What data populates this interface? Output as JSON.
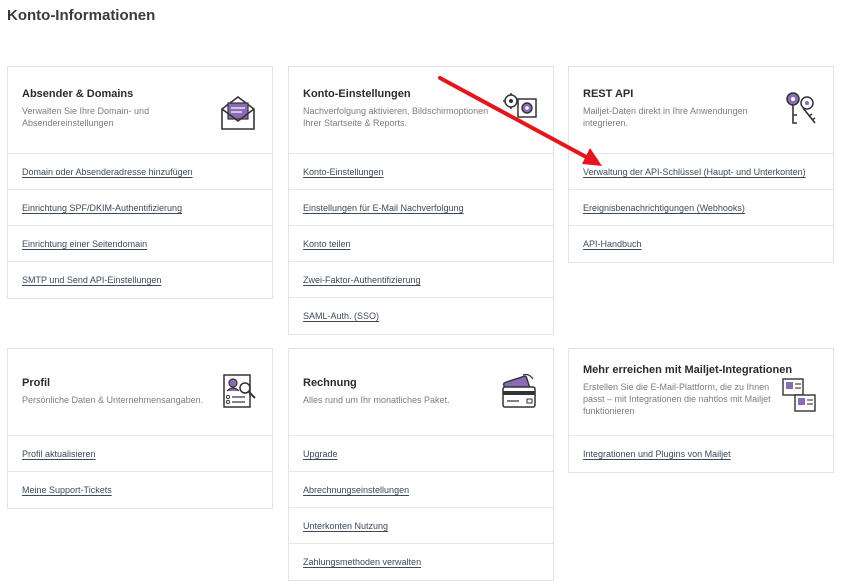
{
  "page_title": "Konto-Informationen",
  "cards": {
    "sender": {
      "title": "Absender & Domains",
      "description": "Verwalten Sie Ihre Domain- und Absendereinstellungen",
      "icon": "envelope-icon",
      "links": [
        "Domain oder Absenderadresse hinzufügen",
        "Einrichtung SPF/DKIM-Authentifizierung",
        "Einrichtung einer Seitendomain",
        "SMTP und Send API-Einstellungen"
      ]
    },
    "account": {
      "title": "Konto-Einstellungen",
      "description": "Nachverfolgung aktivieren, Bildschirmoptionen Ihrer Startseite & Reports.",
      "icon": "gears-icon",
      "links": [
        "Konto-Einstellungen",
        "Einstellungen für E-Mail Nachverfolgung",
        "Konto teilen",
        "Zwei-Faktor-Authentifizierung",
        "SAML-Auth. (SSO)"
      ]
    },
    "rest_api": {
      "title": "REST API",
      "description": "Mailjet-Daten direkt in Ihre Anwendungen integrieren.",
      "icon": "keys-icon",
      "links": [
        "Verwaltung der API-Schlüssel (Haupt- und Unterkonten)",
        "Ereignisbenachrichtigungen (Webhooks)",
        "API-Handbuch"
      ]
    },
    "profile": {
      "title": "Profil",
      "description": "Persönliche Daten & Unternehmensangaben.",
      "icon": "profile-card-icon",
      "links": [
        "Profil aktualisieren",
        "Meine Support-Tickets"
      ]
    },
    "billing": {
      "title": "Rechnung",
      "description": "Alles rund um Ihr monatliches Paket.",
      "icon": "credit-card-icon",
      "links": [
        "Upgrade",
        "Abrechnungseinstellungen",
        "Unterkonten Nutzung",
        "Zahlungsmethoden verwalten"
      ]
    },
    "integrations": {
      "title": "Mehr erreichen mit Mailjet-Integrationen",
      "description": "Erstellen Sie die E-Mail-Plattform, die zu Ihnen passt – mit Integrationen die nahtlos mit Mailjet funktionieren",
      "icon": "integrations-icon",
      "links": [
        "Integrationen und Plugins von Mailjet"
      ]
    }
  },
  "colors": {
    "accent_purple": "#7b5ea7",
    "link": "#3b4b5c",
    "annotation_arrow": "#e8141b"
  }
}
